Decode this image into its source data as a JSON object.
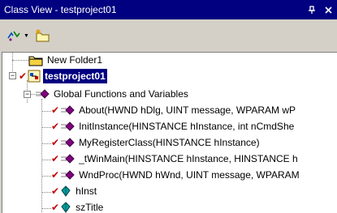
{
  "window": {
    "title": "Class View - testproject01",
    "pin_label": "↑",
    "close_label": "×"
  },
  "toolbar": {
    "sort_icon": "sort-icon",
    "new_folder_icon": "new-folder-icon"
  },
  "tree": {
    "items": [
      {
        "label": "New Folder1",
        "icon": "folder-icon"
      },
      {
        "label": "testproject01",
        "icon": "project-icon",
        "selected": true
      },
      {
        "label": "Global Functions and Variables",
        "icon": "globals-icon"
      },
      {
        "label": "About(HWND hDlg, UINT message, WPARAM wP",
        "icon": "function-icon"
      },
      {
        "label": "InitInstance(HINSTANCE hInstance, int nCmdShe",
        "icon": "function-icon"
      },
      {
        "label": "MyRegisterClass(HINSTANCE hInstance)",
        "icon": "function-icon"
      },
      {
        "label": "_tWinMain(HINSTANCE hInstance, HINSTANCE h",
        "icon": "function-icon"
      },
      {
        "label": "WndProc(HWND hWnd, UINT message, WPARAM",
        "icon": "function-icon"
      },
      {
        "label": "hInst",
        "icon": "variable-icon"
      },
      {
        "label": "szTitle",
        "icon": "variable-icon"
      }
    ]
  },
  "colors": {
    "title_bg": "#000080",
    "selected_bg": "#000080",
    "check": "#c00000",
    "method": "#800080",
    "variable": "#008080"
  }
}
